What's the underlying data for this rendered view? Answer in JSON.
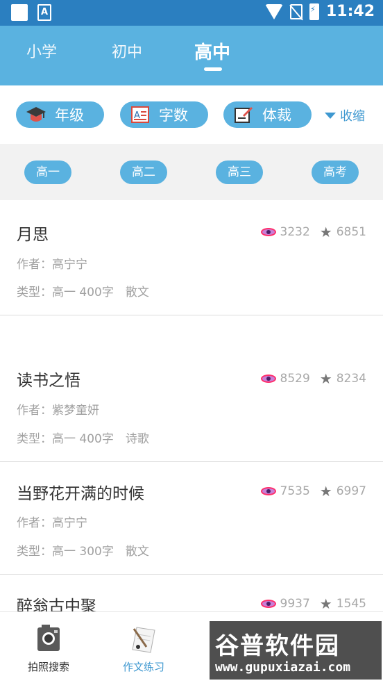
{
  "status_bar": {
    "time": "11:42",
    "notification_icon": "A"
  },
  "level_tabs": [
    {
      "label": "小学"
    },
    {
      "label": "初中"
    },
    {
      "label": "高中",
      "active": true
    }
  ],
  "filters": {
    "grade_label": "年级",
    "wordcount_label": "字数",
    "genre_label": "体裁",
    "collapse_label": "收缩"
  },
  "grades": [
    "高一",
    "高二",
    "高三",
    "高考"
  ],
  "essays": [
    {
      "title": "月思",
      "author": "作者：高宁宁",
      "type": "类型：高一 400字　散文",
      "views": "3232",
      "stars": "6851"
    },
    {
      "title": "读书之悟",
      "author": "作者：紫梦童妍",
      "type": "类型：高一 400字　诗歌",
      "views": "8529",
      "stars": "8234"
    },
    {
      "title": "当野花开满的时候",
      "author": "作者：高宁宁",
      "type": "类型：高一 300字　散文",
      "views": "7535",
      "stars": "6997"
    },
    {
      "title": "醉翁古中聚",
      "author": "",
      "type": "",
      "views": "9937",
      "stars": "1545"
    }
  ],
  "bottom_nav": [
    {
      "label": "拍照搜索",
      "icon": "camera-icon"
    },
    {
      "label": "作文练习",
      "icon": "pen-paper-icon",
      "active": true
    }
  ],
  "watermark": {
    "main": "谷普软件园",
    "sub": "www.gupuxiazai.com"
  },
  "colors": {
    "header_blue": "#5ab2e0",
    "status_blue": "#2b7fc0",
    "accent": "#3e98d0"
  }
}
